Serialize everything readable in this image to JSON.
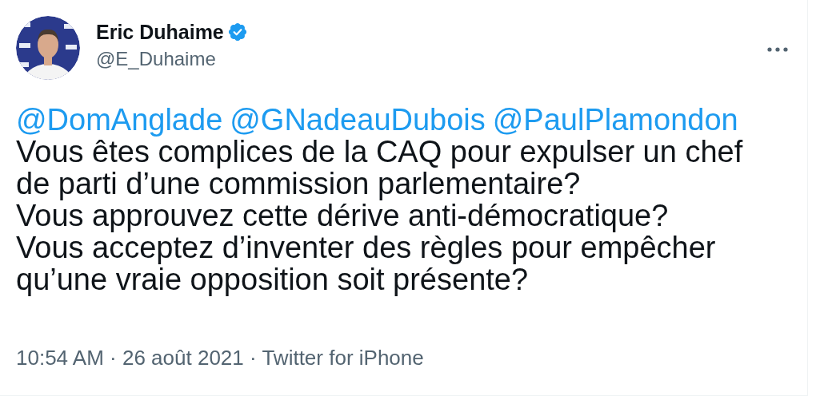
{
  "author": {
    "name": "Eric Duhaime",
    "verified": true,
    "handle": "@E_Duhaime"
  },
  "mentions": [
    "@DomAnglade",
    "@GNadeauDubois",
    "@PaulPlamondon"
  ],
  "body_lines": [
    "Vous êtes complices de la CAQ pour expulser un chef",
    "de parti d’une commission parlementaire?",
    "Vous approuvez cette dérive anti-démocratique?",
    "Vous acceptez d’inventer des règles pour empêcher",
    "qu’une vraie opposition soit présente?"
  ],
  "meta": "10:54 AM · 26 août 2021 · Twitter for iPhone"
}
